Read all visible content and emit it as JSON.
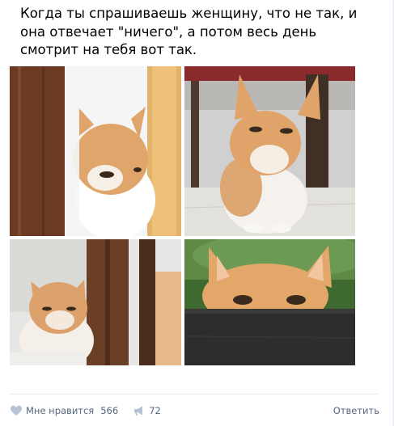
{
  "post": {
    "text_lines": [
      "Когда ты спрашиваешь женщину, что не так, и",
      "она отвечает \"ничего\", а потом весь день",
      "смотрит на тебя вот так."
    ],
    "images": [
      {
        "icon": "cat-peeking-door-photo"
      },
      {
        "icon": "cat-sitting-grumpy-photo"
      },
      {
        "icon": "cat-behind-chair-photo"
      },
      {
        "icon": "cat-peeking-over-edge-photo"
      }
    ]
  },
  "footer": {
    "like_label": "Мне нравится",
    "like_count": "566",
    "repost_count": "72",
    "reply_label": "Ответить",
    "accent_color": "#55677d"
  }
}
